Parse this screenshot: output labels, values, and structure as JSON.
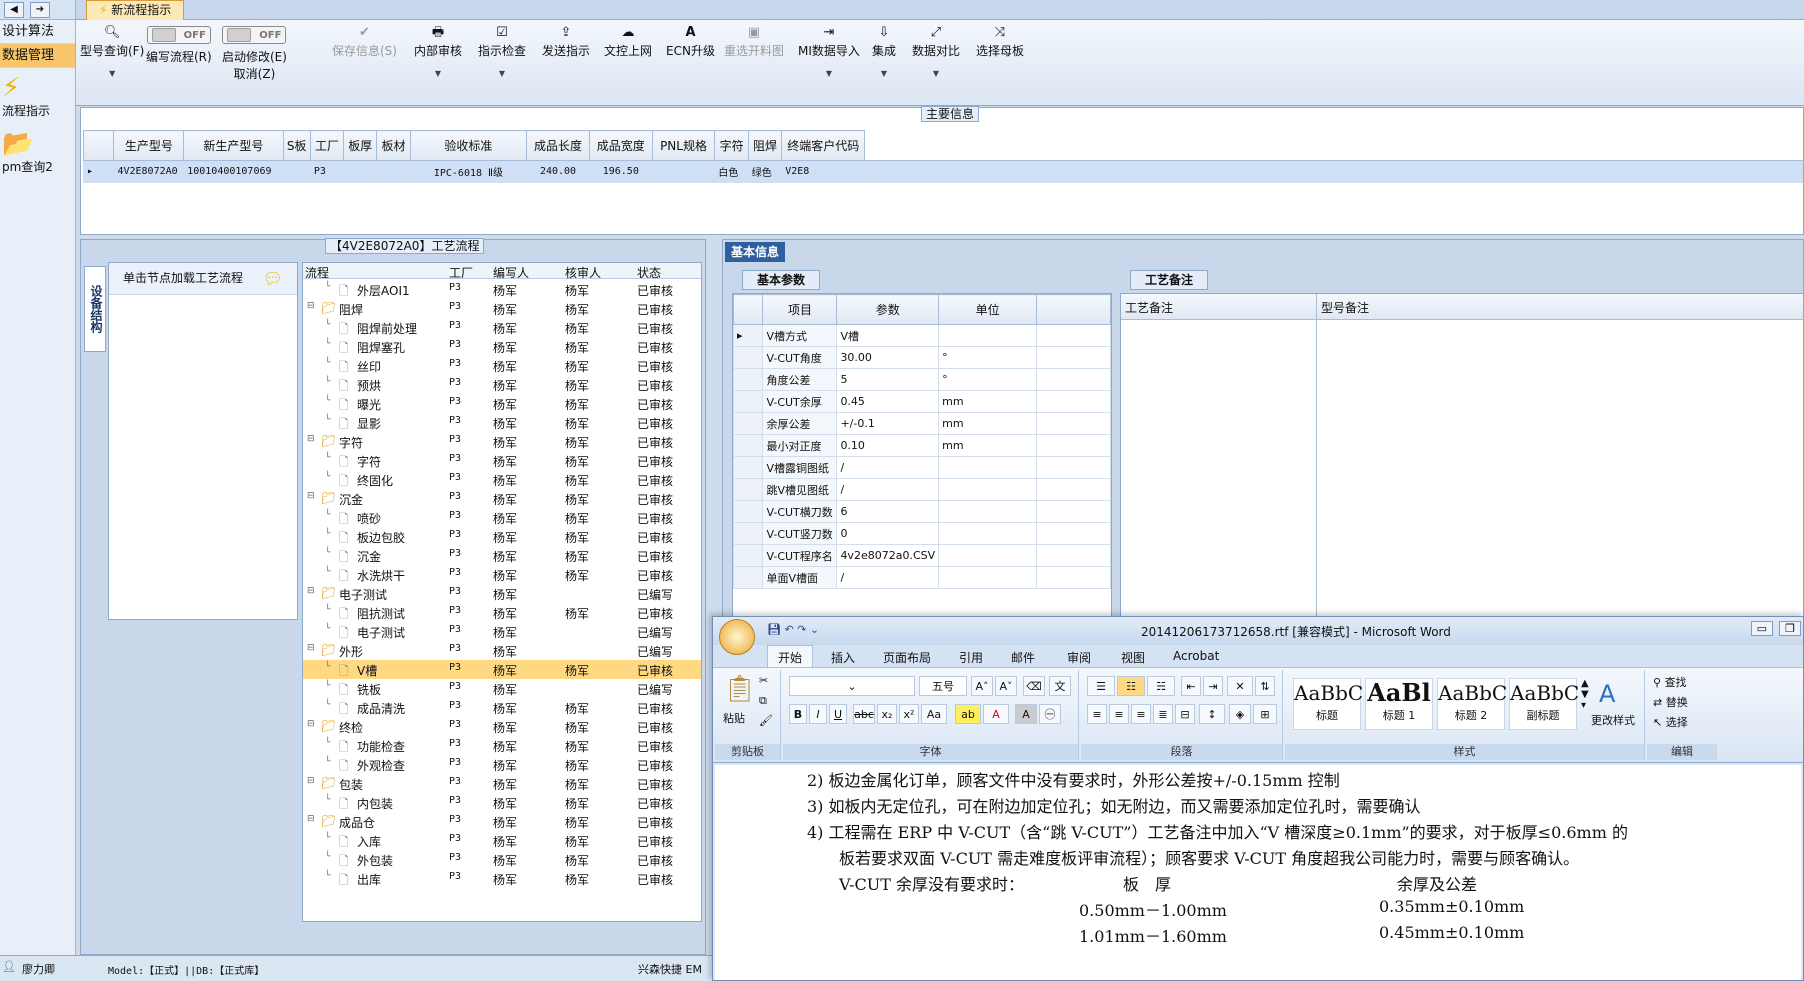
{
  "left_nav": {
    "items": [
      "设计算法",
      "数据管理"
    ],
    "big": [
      {
        "label": "流程指示"
      },
      {
        "label": "pm查询2"
      }
    ]
  },
  "top_tab": "新流程指示",
  "toolbar": {
    "buttons": [
      {
        "label": "型号查询(F)",
        "icon": "search-icon"
      },
      {
        "label": "编写流程(R)",
        "toggle": "OFF"
      },
      {
        "label": "启动修改(E)",
        "sub": "取消(Z)",
        "toggle": "OFF"
      },
      {
        "label": "保存信息(S)",
        "icon": "check-icon"
      },
      {
        "label": "内部审核",
        "icon": "printer-icon"
      },
      {
        "label": "指示检查",
        "icon": "check-icon"
      },
      {
        "label": "发送指示",
        "icon": "upload-icon"
      },
      {
        "label": "文控上网",
        "icon": "cloud-icon"
      },
      {
        "label": "ECN升级",
        "icon": "ab-icon"
      },
      {
        "label": "重选开料图",
        "icon": "image-icon"
      },
      {
        "label": "MI数据导入",
        "icon": "import-icon"
      },
      {
        "label": "集成",
        "icon": "download-icon"
      },
      {
        "label": "数据对比",
        "icon": "compare-icon"
      },
      {
        "label": "选择母板",
        "icon": "shuffle-icon"
      }
    ]
  },
  "main_info": {
    "title": "主要信息",
    "headers": [
      "生产型号",
      "新生产型号",
      "S板",
      "工厂",
      "板厚",
      "板材",
      "验收标准",
      "成品长度",
      "成品宽度",
      "PNL规格",
      "字符",
      "阻焊",
      "终端客户代码"
    ],
    "row": [
      "4V2E8072A0",
      "10010400107069",
      "",
      "P3",
      "",
      "",
      "IPC-6018 Ⅱ级",
      "240.00",
      "196.50",
      "",
      "白色",
      "绿色",
      "V2E8"
    ]
  },
  "process": {
    "title": "【4V2E8072A0】工艺流程",
    "side_tab": "设备结构",
    "hint": "单击节点加载工艺流程",
    "headers": [
      "流程",
      "工厂",
      "编写人",
      "核审人",
      "状态"
    ],
    "rows": [
      {
        "level": 2,
        "name": "外层AOI1",
        "factory": "P3",
        "writer": "杨军",
        "checker": "杨军",
        "status": "已审核"
      },
      {
        "level": 1,
        "name": "阻焊",
        "factory": "P3",
        "writer": "杨军",
        "checker": "杨军",
        "status": "已审核"
      },
      {
        "level": 2,
        "name": "阻焊前处理",
        "factory": "P3",
        "writer": "杨军",
        "checker": "杨军",
        "status": "已审核"
      },
      {
        "level": 2,
        "name": "阻焊塞孔",
        "factory": "P3",
        "writer": "杨军",
        "checker": "杨军",
        "status": "已审核"
      },
      {
        "level": 2,
        "name": "丝印",
        "factory": "P3",
        "writer": "杨军",
        "checker": "杨军",
        "status": "已审核"
      },
      {
        "level": 2,
        "name": "预烘",
        "factory": "P3",
        "writer": "杨军",
        "checker": "杨军",
        "status": "已审核"
      },
      {
        "level": 2,
        "name": "曝光",
        "factory": "P3",
        "writer": "杨军",
        "checker": "杨军",
        "status": "已审核"
      },
      {
        "level": 2,
        "name": "显影",
        "factory": "P3",
        "writer": "杨军",
        "checker": "杨军",
        "status": "已审核"
      },
      {
        "level": 1,
        "name": "字符",
        "factory": "P3",
        "writer": "杨军",
        "checker": "杨军",
        "status": "已审核"
      },
      {
        "level": 2,
        "name": "字符",
        "factory": "P3",
        "writer": "杨军",
        "checker": "杨军",
        "status": "已审核"
      },
      {
        "level": 2,
        "name": "终固化",
        "factory": "P3",
        "writer": "杨军",
        "checker": "杨军",
        "status": "已审核"
      },
      {
        "level": 1,
        "name": "沉金",
        "factory": "P3",
        "writer": "杨军",
        "checker": "杨军",
        "status": "已审核"
      },
      {
        "level": 2,
        "name": "喷砂",
        "factory": "P3",
        "writer": "杨军",
        "checker": "杨军",
        "status": "已审核"
      },
      {
        "level": 2,
        "name": "板边包胶",
        "factory": "P3",
        "writer": "杨军",
        "checker": "杨军",
        "status": "已审核"
      },
      {
        "level": 2,
        "name": "沉金",
        "factory": "P3",
        "writer": "杨军",
        "checker": "杨军",
        "status": "已审核"
      },
      {
        "level": 2,
        "name": "水洗烘干",
        "factory": "P3",
        "writer": "杨军",
        "checker": "杨军",
        "status": "已审核"
      },
      {
        "level": 1,
        "name": "电子测试",
        "factory": "P3",
        "writer": "杨军",
        "checker": "",
        "status": "已编写"
      },
      {
        "level": 2,
        "name": "阻抗测试",
        "factory": "P3",
        "writer": "杨军",
        "checker": "杨军",
        "status": "已审核"
      },
      {
        "level": 2,
        "name": "电子测试",
        "factory": "P3",
        "writer": "杨军",
        "checker": "",
        "status": "已编写"
      },
      {
        "level": 1,
        "name": "外形",
        "factory": "P3",
        "writer": "杨军",
        "checker": "",
        "status": "已编写"
      },
      {
        "level": 2,
        "name": "V槽",
        "factory": "P3",
        "writer": "杨军",
        "checker": "杨军",
        "status": "已审核",
        "selected": true
      },
      {
        "level": 2,
        "name": "铣板",
        "factory": "P3",
        "writer": "杨军",
        "checker": "",
        "status": "已编写"
      },
      {
        "level": 2,
        "name": "成品清洗",
        "factory": "P3",
        "writer": "杨军",
        "checker": "杨军",
        "status": "已审核"
      },
      {
        "level": 1,
        "name": "终检",
        "factory": "P3",
        "writer": "杨军",
        "checker": "杨军",
        "status": "已审核"
      },
      {
        "level": 2,
        "name": "功能检查",
        "factory": "P3",
        "writer": "杨军",
        "checker": "杨军",
        "status": "已审核"
      },
      {
        "level": 2,
        "name": "外观检查",
        "factory": "P3",
        "writer": "杨军",
        "checker": "杨军",
        "status": "已审核"
      },
      {
        "level": 1,
        "name": "包装",
        "factory": "P3",
        "writer": "杨军",
        "checker": "杨军",
        "status": "已审核"
      },
      {
        "level": 2,
        "name": "内包装",
        "factory": "P3",
        "writer": "杨军",
        "checker": "杨军",
        "status": "已审核"
      },
      {
        "level": 1,
        "name": "成品仓",
        "factory": "P3",
        "writer": "杨军",
        "checker": "杨军",
        "status": "已审核"
      },
      {
        "level": 2,
        "name": "入库",
        "factory": "P3",
        "writer": "杨军",
        "checker": "杨军",
        "status": "已审核"
      },
      {
        "level": 2,
        "name": "外包装",
        "factory": "P3",
        "writer": "杨军",
        "checker": "杨军",
        "status": "已审核"
      },
      {
        "level": 2,
        "name": "出库",
        "factory": "P3",
        "writer": "杨军",
        "checker": "杨军",
        "status": "已审核"
      }
    ]
  },
  "basic_info": {
    "title": "基本信息",
    "params_tab": "基本参数",
    "notes_tab": "工艺备注",
    "param_headers": [
      "项目",
      "参数",
      "单位"
    ],
    "params": [
      [
        "V槽方式",
        "V槽",
        ""
      ],
      [
        "V-CUT角度",
        "30.00",
        "°"
      ],
      [
        "角度公差",
        "5",
        "°"
      ],
      [
        "V-CUT余厚",
        "0.45",
        "mm"
      ],
      [
        "余厚公差",
        "+/-0.1",
        "mm"
      ],
      [
        "最小对正度",
        "0.10",
        "mm"
      ],
      [
        "V槽露铜图纸",
        "/",
        ""
      ],
      [
        "跳V槽见图纸",
        "/",
        ""
      ],
      [
        "V-CUT横刀数",
        "6",
        ""
      ],
      [
        "V-CUT竖刀数",
        "0",
        ""
      ],
      [
        "V-CUT程序名",
        "4v2e8072a0.CSV",
        ""
      ],
      [
        "单面V槽面",
        "/",
        ""
      ]
    ],
    "note_headers": [
      "工艺备注",
      "型号备注"
    ]
  },
  "status_bar": {
    "user": "廖力卿",
    "model": "Model:【正式】||DB:【正式库】",
    "right": "兴森快捷 EM"
  },
  "word": {
    "title": "20141206173712658.rtf [兼容模式] - Microsoft Word",
    "tabs": [
      "开始",
      "插入",
      "页面布局",
      "引用",
      "邮件",
      "审阅",
      "视图",
      "Acrobat"
    ],
    "groups": [
      "剪贴板",
      "字体",
      "段落",
      "样式",
      "编辑"
    ],
    "paste": "粘贴",
    "font_size": "五号",
    "styles": [
      {
        "preview": "AaBbC",
        "name": "标题"
      },
      {
        "preview": "AaBl",
        "name": "标题 1"
      },
      {
        "preview": "AaBbC",
        "name": "标题 2"
      },
      {
        "preview": "AaBbC",
        "name": "副标题"
      }
    ],
    "change_styles": "更改样式",
    "edit": [
      "查找",
      "替换",
      "选择"
    ],
    "lines": [
      "2)  板边金属化订单，顾客文件中没有要求时，外形公差按+/-0.15mm 控制",
      "3)  如板内无定位孔，可在附边加定位孔；如无附边，而又需要添加定位孔时，需要确认",
      "4)  工程需在 ERP 中 V-CUT（含“跳 V-CUT”）工艺备注中加入“V 槽深度≥0.1mm”的要求，对于板厚≤0.6mm 的",
      "板若要求双面 V-CUT 需走难度板评审流程）；顾客要求 V-CUT 角度超我公司能力时，需要与顾客确认。",
      "V-CUT 余厚没有要求时：",
      "板　厚",
      "余厚及公差",
      "0.50mm－1.00mm",
      "0.35mm±0.10mm",
      "1.01mm－1.60mm",
      "0.45mm±0.10mm"
    ]
  }
}
